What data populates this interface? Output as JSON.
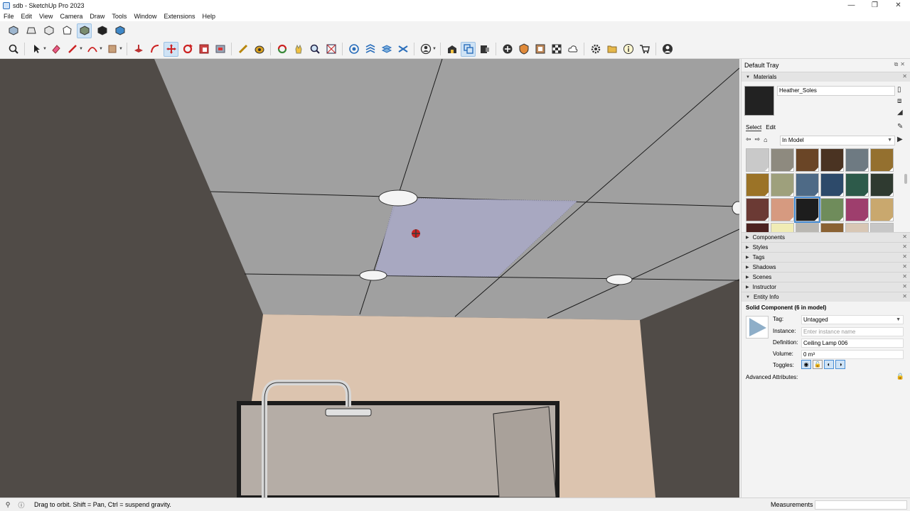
{
  "window": {
    "title": "sdb - SketchUp Pro 2023",
    "controls": {
      "minimize": "—",
      "maximize": "❐",
      "close": "✕"
    }
  },
  "menu": [
    "File",
    "Edit",
    "View",
    "Camera",
    "Draw",
    "Tools",
    "Window",
    "Extensions",
    "Help"
  ],
  "tray": {
    "title": "Default Tray",
    "materials": {
      "header": "Materials",
      "current_name": "Heather_Soles",
      "tabs": {
        "select": "Select",
        "edit": "Edit"
      },
      "library": "In Model",
      "swatch_colors": [
        "#c9c9c9",
        "#8e8a7f",
        "#6a4526",
        "#4a3322",
        "#6e7a82",
        "#94702f",
        "#9b7327",
        "#9ea07c",
        "#4e6a86",
        "#2d4a6a",
        "#2d5a4a",
        "#2f3a30",
        "#6b3a34",
        "#d69a80",
        "#1d1d1d",
        "#6f8c5b",
        "#9e3e6d",
        "#c9a86e",
        "#4c2220",
        "#f0ecb5",
        "#b9b7b2",
        "#8a6233",
        "#d8c7b5",
        "#c7c7c7"
      ],
      "selected_index": 14
    },
    "collapsed_panels": [
      "Components",
      "Styles",
      "Tags",
      "Shadows",
      "Scenes",
      "Instructor"
    ],
    "entity_info": {
      "header": "Entity Info",
      "title": "Solid Component (6 in model)",
      "tag_label": "Tag:",
      "tag_value": "Untagged",
      "instance_label": "Instance:",
      "instance_placeholder": "Enter instance name",
      "definition_label": "Definition:",
      "definition_value": "Ceiling Lamp 006",
      "volume_label": "Volume:",
      "volume_value": "0 m³",
      "toggles_label": "Toggles:",
      "advanced": "Advanced Attributes:"
    }
  },
  "status": {
    "text": "Drag to orbit. Shift = Pan, Ctrl = suspend gravity.",
    "measurements_label": "Measurements",
    "measurements_value": ""
  },
  "colors": {
    "ceiling": "#a0a0a0",
    "wall_dark": "#504b47",
    "wall_peach": "#dcc4af",
    "selection": "#a9a9c3",
    "accent": "#4a8fd6"
  }
}
